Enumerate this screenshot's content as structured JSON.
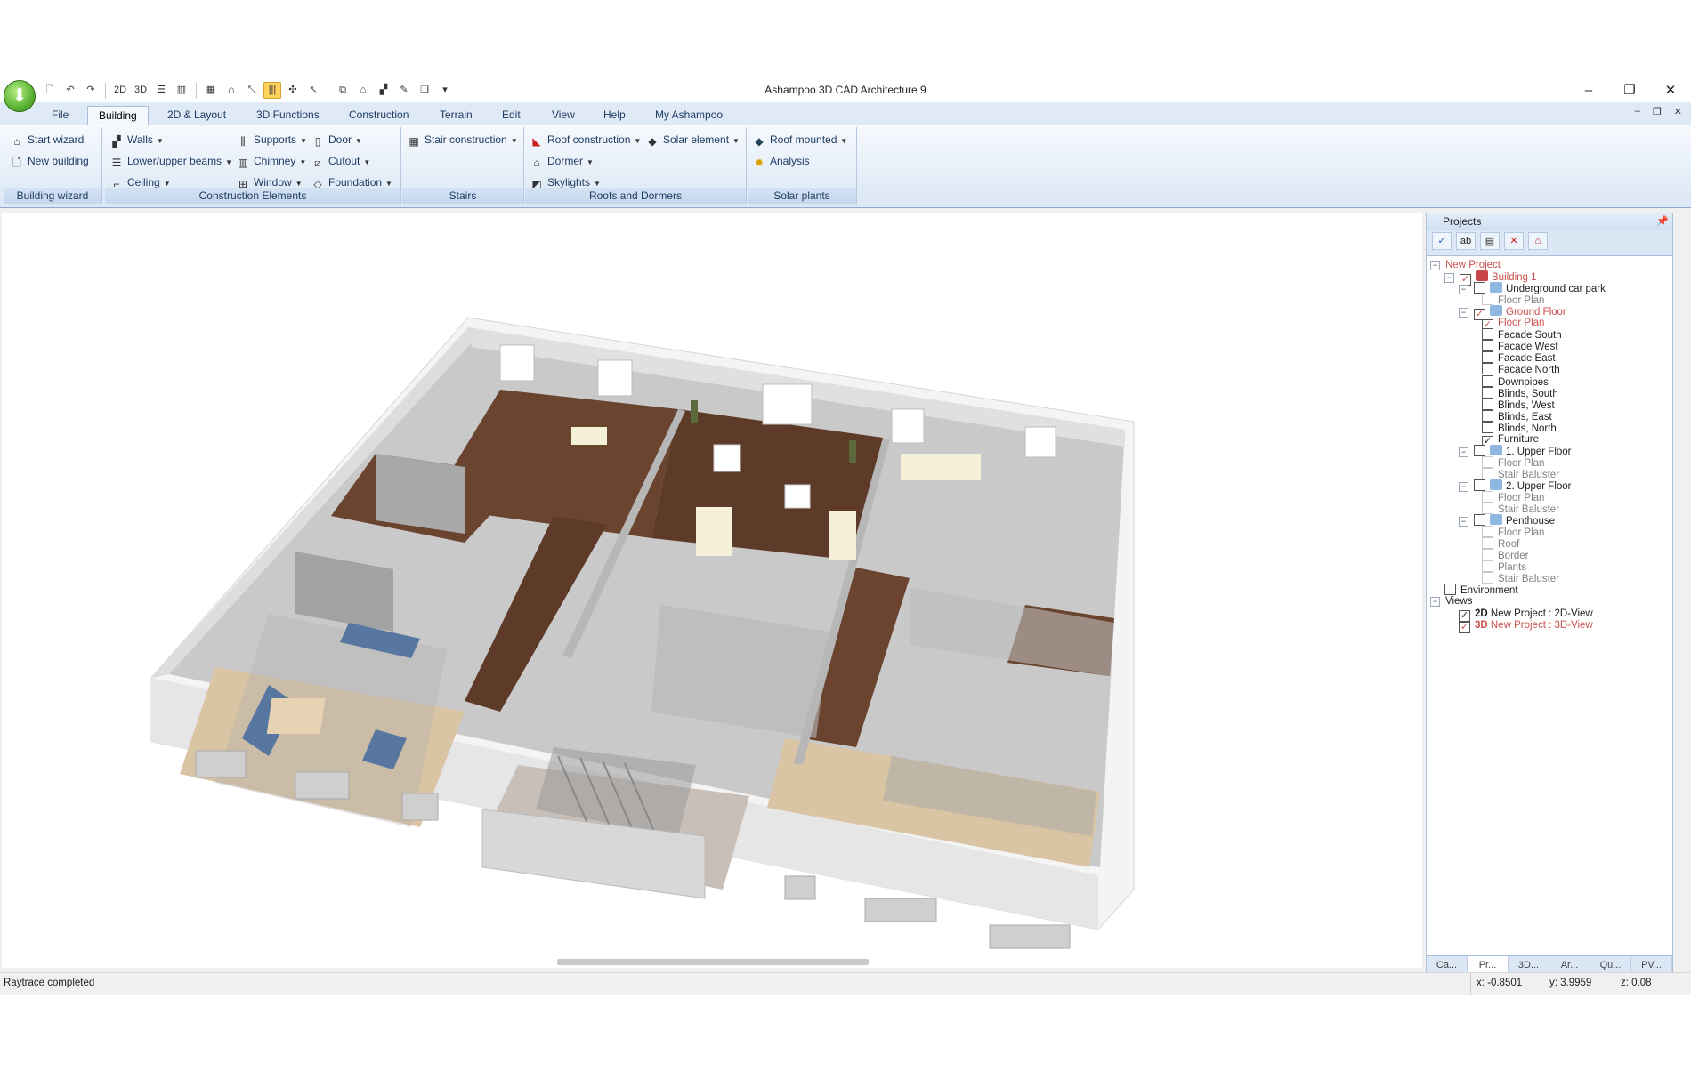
{
  "titlebar": {
    "title": "Ashampoo 3D CAD Architecture 9",
    "minimize": "–",
    "maximize": "❐",
    "close": "✕"
  },
  "quick_access": [
    {
      "icon": "new-doc-icon",
      "glyph": "🗋"
    },
    {
      "icon": "undo-icon",
      "glyph": "↶"
    },
    {
      "icon": "redo-icon",
      "glyph": "↷"
    },
    {
      "icon": "2d-view-icon",
      "glyph": "2D"
    },
    {
      "icon": "3d-view-icon",
      "glyph": "3D"
    },
    {
      "icon": "floors-icon",
      "glyph": "☰"
    },
    {
      "icon": "split-view-icon",
      "glyph": "▥"
    },
    {
      "icon": "grid-icon",
      "glyph": "▦"
    },
    {
      "icon": "magnet-icon",
      "glyph": "∩"
    },
    {
      "icon": "select-icon",
      "glyph": "⤡"
    },
    {
      "icon": "bars-icon",
      "glyph": "|||"
    },
    {
      "icon": "snap-icon",
      "glyph": "✣"
    },
    {
      "icon": "pointer-icon",
      "glyph": "↖"
    },
    {
      "icon": "copy-icon",
      "glyph": "⧉"
    },
    {
      "icon": "roof-icon",
      "glyph": "⌂"
    },
    {
      "icon": "terrain-icon",
      "glyph": "▞"
    },
    {
      "icon": "pen-icon",
      "glyph": "✎"
    },
    {
      "icon": "layers-icon",
      "glyph": "❏"
    },
    {
      "icon": "customize-icon",
      "glyph": "▾"
    }
  ],
  "tabs": [
    "File",
    "Building",
    "2D & Layout",
    "3D Functions",
    "Construction",
    "Terrain",
    "Edit",
    "View",
    "Help",
    "My Ashampoo"
  ],
  "selected_tab": "Building",
  "ribbon": {
    "building_wizard": {
      "label": "Building wizard",
      "start": "Start wizard",
      "new": "New building"
    },
    "construction_elements": {
      "label": "Construction Elements",
      "walls": "Walls",
      "beams": "Lower/upper beams",
      "ceiling": "Ceiling",
      "supports": "Supports",
      "chimney": "Chimney",
      "window": "Window",
      "door": "Door",
      "cutout": "Cutout",
      "foundation": "Foundation"
    },
    "stairs": {
      "label": "Stairs",
      "stair_construction": "Stair construction"
    },
    "roofs": {
      "label": "Roofs and Dormers",
      "roof_construction": "Roof construction",
      "dormer": "Dormer",
      "skylights": "Skylights",
      "solar_element": "Solar element"
    },
    "solar": {
      "label": "Solar plants",
      "roof_mounted": "Roof mounted",
      "analysis": "Analysis"
    }
  },
  "panel": {
    "title": "Projects",
    "tree": [
      {
        "label": "New Project",
        "level": 0,
        "exp": "⊟",
        "cb": null,
        "style": "hl"
      },
      {
        "label": "Building 1",
        "level": 1,
        "exp": "⊟",
        "cb": "✓",
        "style": "hl",
        "icon": "building-icon"
      },
      {
        "label": "Underground car park",
        "level": 2,
        "exp": "⊟",
        "cb": "",
        "style": "",
        "icon": "floor-icon"
      },
      {
        "label": "Floor Plan",
        "level": 3,
        "exp": null,
        "cb": "",
        "style": "dim"
      },
      {
        "label": "Ground Floor",
        "level": 2,
        "exp": "⊟",
        "cb": "✓",
        "style": "hl",
        "icon": "floor-icon"
      },
      {
        "label": "Floor Plan",
        "level": 3,
        "exp": null,
        "cb": "✓",
        "style": "hl"
      },
      {
        "label": "Facade South",
        "level": 3,
        "exp": null,
        "cb": "",
        "style": ""
      },
      {
        "label": "Facade West",
        "level": 3,
        "exp": null,
        "cb": "",
        "style": ""
      },
      {
        "label": "Facade East",
        "level": 3,
        "exp": null,
        "cb": "",
        "style": ""
      },
      {
        "label": "Facade North",
        "level": 3,
        "exp": null,
        "cb": "",
        "style": ""
      },
      {
        "label": "Downpipes",
        "level": 3,
        "exp": null,
        "cb": "",
        "style": ""
      },
      {
        "label": "Blinds, South",
        "level": 3,
        "exp": null,
        "cb": "",
        "style": ""
      },
      {
        "label": "Blinds, West",
        "level": 3,
        "exp": null,
        "cb": "",
        "style": ""
      },
      {
        "label": "Blinds, East",
        "level": 3,
        "exp": null,
        "cb": "",
        "style": ""
      },
      {
        "label": "Blinds, North",
        "level": 3,
        "exp": null,
        "cb": "",
        "style": ""
      },
      {
        "label": "Furniture",
        "level": 3,
        "exp": null,
        "cb": "✓",
        "style": ""
      },
      {
        "label": "1. Upper Floor",
        "level": 2,
        "exp": "⊟",
        "cb": "",
        "style": "",
        "icon": "floor-icon"
      },
      {
        "label": "Floor Plan",
        "level": 3,
        "exp": null,
        "cb": "",
        "style": "dim"
      },
      {
        "label": "Stair Baluster",
        "level": 3,
        "exp": null,
        "cb": "",
        "style": "dim"
      },
      {
        "label": "2. Upper Floor",
        "level": 2,
        "exp": "⊟",
        "cb": "",
        "style": "",
        "icon": "floor-icon"
      },
      {
        "label": "Floor Plan",
        "level": 3,
        "exp": null,
        "cb": "",
        "style": "dim"
      },
      {
        "label": "Stair Baluster",
        "level": 3,
        "exp": null,
        "cb": "",
        "style": "dim"
      },
      {
        "label": "Penthouse",
        "level": 2,
        "exp": "⊟",
        "cb": "",
        "style": "",
        "icon": "floor-icon"
      },
      {
        "label": "Floor Plan",
        "level": 3,
        "exp": null,
        "cb": "",
        "style": "dim"
      },
      {
        "label": "Roof",
        "level": 3,
        "exp": null,
        "cb": "",
        "style": "dim"
      },
      {
        "label": "Border",
        "level": 3,
        "exp": null,
        "cb": "",
        "style": "dim"
      },
      {
        "label": "Plants",
        "level": 3,
        "exp": null,
        "cb": "",
        "style": "dim"
      },
      {
        "label": "Stair Baluster",
        "level": 3,
        "exp": null,
        "cb": "",
        "style": "dim"
      },
      {
        "label": "Environment",
        "level": 1,
        "exp": null,
        "cb": "",
        "style": ""
      },
      {
        "label": "Views",
        "level": 0,
        "exp": "⊟",
        "cb": null,
        "style": ""
      },
      {
        "label": "New Project : 2D-View",
        "level": 2,
        "exp": null,
        "cb": "✓",
        "style": "",
        "prefix": "2D"
      },
      {
        "label": "New Project : 3D-View",
        "level": 2,
        "exp": null,
        "cb": "✓",
        "style": "hl",
        "prefix": "3D"
      }
    ],
    "bottom_tabs": [
      "Ca...",
      "Pr...",
      "3D...",
      "Ar...",
      "Qu...",
      "PV..."
    ]
  },
  "status": {
    "text": "Raytrace completed",
    "x": "x: -0.8501",
    "y": "y: 3.9959",
    "z": "z: 0.08"
  },
  "colors": {
    "highlight_text": "#c8504d",
    "ribbon_label": "#1e3b62",
    "floor_wood": "#6b4430",
    "floor_beige": "#d9c4a4"
  }
}
